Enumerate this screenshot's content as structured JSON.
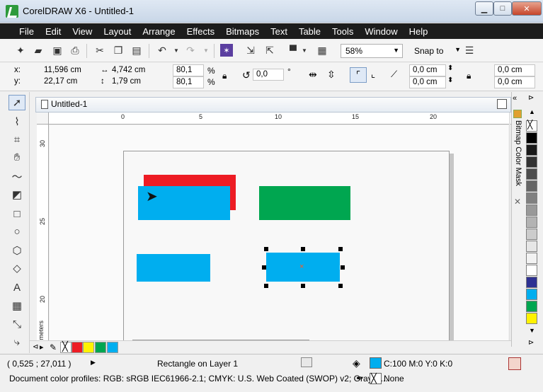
{
  "window": {
    "title": "CorelDRAW X6 - Untitled-1"
  },
  "menu": [
    "File",
    "Edit",
    "View",
    "Layout",
    "Arrange",
    "Effects",
    "Bitmaps",
    "Text",
    "Table",
    "Tools",
    "Window",
    "Help"
  ],
  "toolbar": {
    "zoom": "58%",
    "snap_to": "Snap to"
  },
  "property_bar": {
    "x": "11,596 cm",
    "y": "22,17 cm",
    "width": "4,742 cm",
    "height": "1,79 cm",
    "scale_w": "80,1",
    "scale_h": "80,1",
    "percent": "%",
    "rotation": "0,0",
    "degree": "°",
    "corner_tl": "0,0 cm",
    "corner_bl": "0,0 cm",
    "corner_tr": "0,0 cm",
    "corner_br": "0,0 cm"
  },
  "document": {
    "tab_title": "Untitled-1",
    "ruler_top": [
      "0",
      "5",
      "10",
      "15",
      "20"
    ],
    "ruler_left": [
      "30",
      "25",
      "20"
    ],
    "ruler_unit": "timeters"
  },
  "docker": {
    "title": "Bitmap Color Mask"
  },
  "status": {
    "coords": "( 0,525 ; 27,011 )",
    "selection": "Rectangle on Layer 1",
    "profiles": "Document color profiles: RGB: sRGB IEC61966-2.1; CMYK: U.S. Web Coated (SWOP) v2; Graysc...",
    "fill": "C:100 M:0 Y:0 K:0",
    "outline": "None"
  },
  "colors": {
    "red": "#ed1c24",
    "cyan": "#00aeef",
    "green": "#00a650",
    "yellow": "#fff200",
    "blue": "#2e3192"
  }
}
